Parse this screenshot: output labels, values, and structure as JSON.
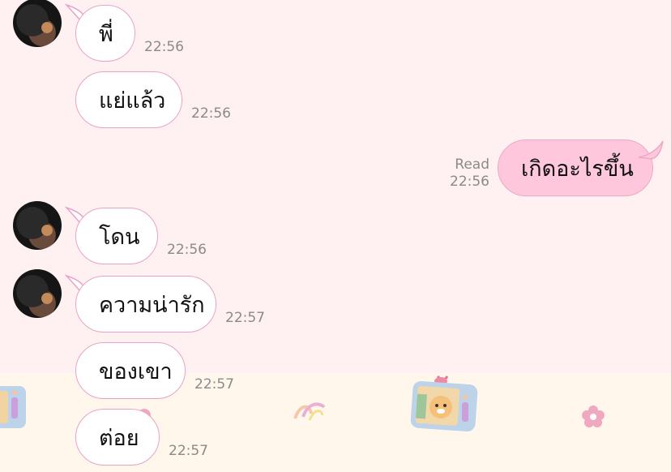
{
  "messages": [
    {
      "side": "in",
      "text": "พี่",
      "time": "22:56"
    },
    {
      "side": "in",
      "text": "แย่แล้ว",
      "time": "22:56"
    },
    {
      "side": "out",
      "text": "เกิดอะไรขึ้น",
      "status": "Read",
      "time": "22:56"
    },
    {
      "side": "in",
      "text": "โดน",
      "time": "22:56"
    },
    {
      "side": "in",
      "text": "ความน่ารัก",
      "time": "22:57"
    },
    {
      "side": "in",
      "text": "ของเขา",
      "time": "22:57"
    },
    {
      "side": "in",
      "text": "ต่อย",
      "time": "22:57"
    }
  ],
  "colors": {
    "chat_background": "#fff1f1",
    "wallpaper_band": "#fff7ec",
    "incoming_bubble": "#ffffff",
    "incoming_border": "#e8a2c6",
    "outgoing_bubble": "#ffc7dc",
    "timestamp": "#8a8a8a"
  },
  "icons": [
    "contact-avatar",
    "tiger-tv-sticker",
    "confetti-ribbon-sticker",
    "pink-flower-sticker"
  ]
}
